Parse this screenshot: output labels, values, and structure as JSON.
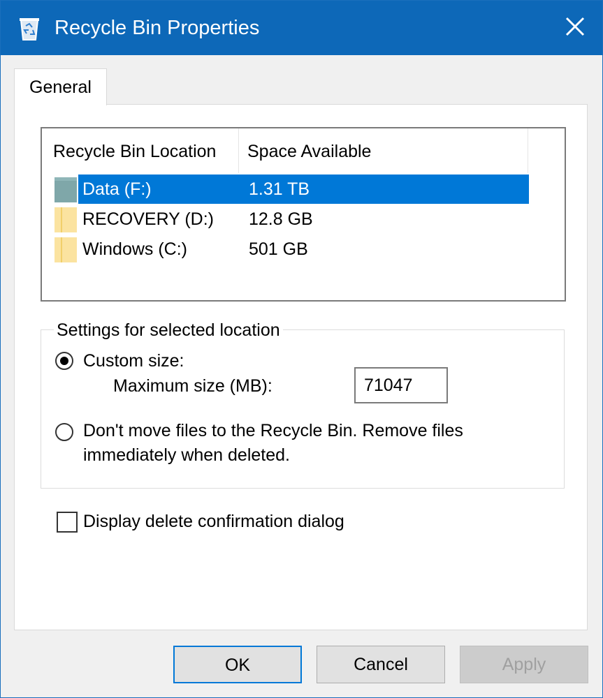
{
  "window": {
    "title": "Recycle Bin Properties",
    "accent_color": "#0d68b8"
  },
  "tabs": [
    {
      "label": "General",
      "selected": true
    }
  ],
  "locations": {
    "headers": [
      "Recycle Bin Location",
      "Space Available"
    ],
    "rows": [
      {
        "name": "Data (F:)",
        "space": "1.31 TB",
        "selected": true,
        "icon": "drive-icon"
      },
      {
        "name": "RECOVERY (D:)",
        "space": "12.8 GB",
        "selected": false,
        "icon": "folder-icon"
      },
      {
        "name": "Windows (C:)",
        "space": "501 GB",
        "selected": false,
        "icon": "folder-icon"
      }
    ]
  },
  "settings": {
    "group_label": "Settings for selected location",
    "custom_size_label": "Custom size:",
    "custom_size_selected": true,
    "max_size_label": "Maximum size (MB):",
    "max_size_value": "71047",
    "dont_move_line1": "Don't move files to the Recycle Bin. Remove files",
    "dont_move_line2": "immediately when deleted.",
    "dont_move_selected": false
  },
  "confirm_dialog": {
    "label": "Display delete confirmation dialog",
    "checked": false
  },
  "buttons": {
    "ok": "OK",
    "cancel": "Cancel",
    "apply": "Apply"
  }
}
